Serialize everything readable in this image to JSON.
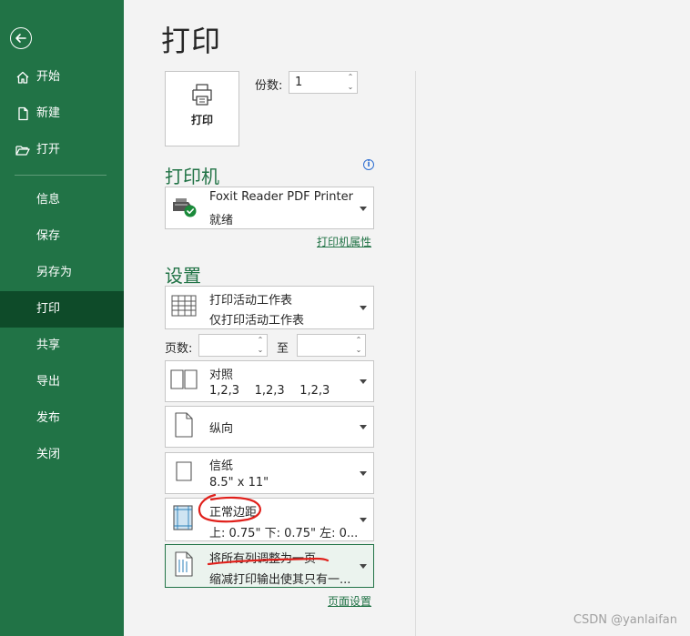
{
  "sidebar": {
    "items": [
      {
        "label": "开始",
        "icon": "home-icon"
      },
      {
        "label": "新建",
        "icon": "new-file-icon"
      },
      {
        "label": "打开",
        "icon": "folder-open-icon"
      },
      {
        "label": "信息"
      },
      {
        "label": "保存"
      },
      {
        "label": "另存为"
      },
      {
        "label": "打印",
        "active": true
      },
      {
        "label": "共享"
      },
      {
        "label": "导出"
      },
      {
        "label": "发布"
      },
      {
        "label": "关闭"
      }
    ]
  },
  "page": {
    "title": "打印"
  },
  "print_button": {
    "label": "打印"
  },
  "copies": {
    "label": "份数:",
    "value": "1"
  },
  "printer": {
    "heading": "打印机",
    "name": "Foxit Reader PDF Printer",
    "status": "就绪",
    "properties_link": "打印机属性"
  },
  "settings": {
    "heading": "设置",
    "scope": {
      "title": "打印活动工作表",
      "subtitle": "仅打印活动工作表"
    },
    "pages": {
      "label": "页数:",
      "to_label": "至",
      "from_value": "",
      "to_value": ""
    },
    "collate": {
      "title": "对照",
      "subtitle": "1,2,3    1,2,3    1,2,3"
    },
    "orientation": {
      "title": "纵向"
    },
    "paper": {
      "title": "信纸",
      "subtitle": "8.5\" x 11\""
    },
    "margins": {
      "title": "正常边距",
      "subtitle": "上: 0.75\" 下: 0.75\" 左: 0..."
    },
    "scaling": {
      "title": "将所有列调整为一页",
      "subtitle": "缩减打印输出使其只有一..."
    },
    "page_setup_link": "页面设置"
  },
  "watermark": "CSDN @yanlaifan",
  "colors": {
    "accent": "#217346",
    "sidebar_active": "#0e4b29",
    "annotation": "#e0201b"
  }
}
